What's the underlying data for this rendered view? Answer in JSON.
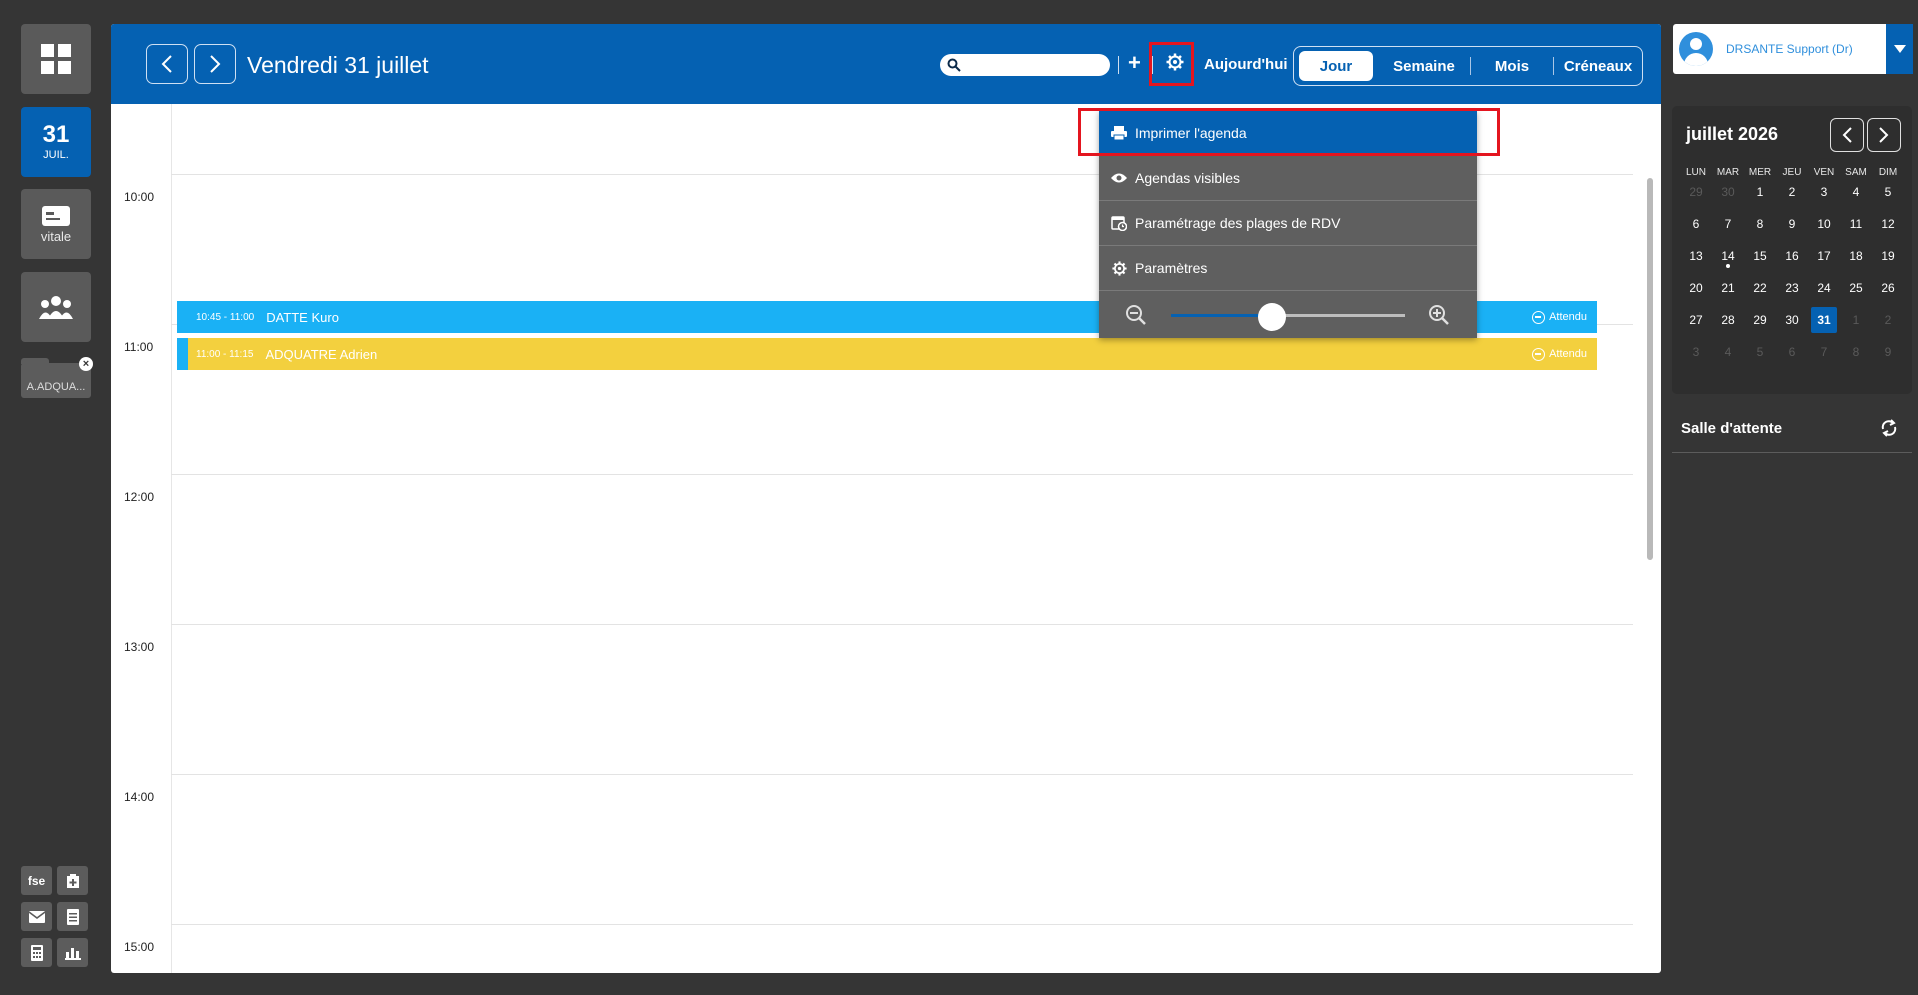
{
  "rail": {
    "date_day": "31",
    "date_month": "JUIL.",
    "vitale_label": "vitale",
    "patient_folder": "A.ADQUA...",
    "fse_label": "fse"
  },
  "header": {
    "title": "Vendredi 31 juillet",
    "search_placeholder": "",
    "plus": "+",
    "today": "Aujourd'hui",
    "views": [
      "Jour",
      "Semaine",
      "Mois",
      "Créneaux"
    ],
    "active_view": "Jour"
  },
  "agenda": {
    "hours": [
      "10:00",
      "11:00",
      "12:00",
      "13:00",
      "14:00",
      "15:00"
    ],
    "appointments": [
      {
        "time": "10:45 - 11:00",
        "name": "DATTE Kuro",
        "status": "Attendu",
        "color": "#1ab1f5",
        "strip": "#1ab1f5"
      },
      {
        "time": "11:00 - 11:15",
        "name": "ADQUATRE Adrien",
        "status": "Attendu",
        "color": "#f3d03e",
        "strip": "#1ab1f5"
      }
    ]
  },
  "settings_menu": {
    "items": [
      "Imprimer l'agenda",
      "Agendas visibles",
      "Paramétrage des plages de RDV",
      "Paramètres"
    ],
    "zoom_level": 0.43
  },
  "user": {
    "name": "DRSANTE Support (Dr)"
  },
  "mini_calendar": {
    "title": "juillet 2026",
    "weekdays": [
      "LUN",
      "MAR",
      "MER",
      "JEU",
      "VEN",
      "SAM",
      "DIM"
    ],
    "weeks": [
      [
        "29",
        "30",
        "1",
        "2",
        "3",
        "4",
        "5"
      ],
      [
        "6",
        "7",
        "8",
        "9",
        "10",
        "11",
        "12"
      ],
      [
        "13",
        "14",
        "15",
        "16",
        "17",
        "18",
        "19"
      ],
      [
        "20",
        "21",
        "22",
        "23",
        "24",
        "25",
        "26"
      ],
      [
        "27",
        "28",
        "29",
        "30",
        "31",
        "1",
        "2"
      ],
      [
        "3",
        "4",
        "5",
        "6",
        "7",
        "8",
        "9"
      ]
    ],
    "selected": "31",
    "today_marker": "14"
  },
  "waiting_room": {
    "title": "Salle d'attente"
  },
  "colors": {
    "primary": "#0561b2",
    "highlight": "#e4151f",
    "appt_blue": "#1ab1f5",
    "appt_yellow": "#f3d03e"
  }
}
